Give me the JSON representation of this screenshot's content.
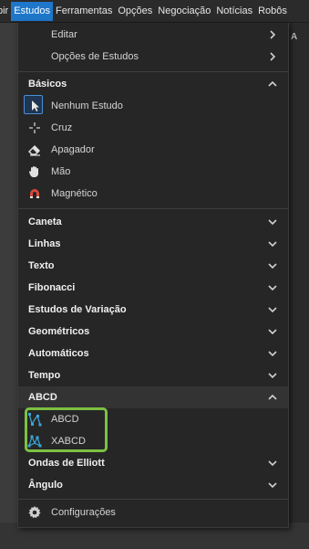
{
  "menubar": {
    "items": [
      "bir",
      "Estudos",
      "Ferramentas",
      "Opções",
      "Negociação",
      "Notícias",
      "Robôs"
    ]
  },
  "side_glyph": "A",
  "menu": {
    "top_items": [
      "Editar",
      "Opções de Estudos"
    ],
    "basicos": {
      "title": "Básicos",
      "items": [
        "Nenhum Estudo",
        "Cruz",
        "Apagador",
        "Mão",
        "Magnético"
      ]
    },
    "groups_a": [
      "Caneta",
      "Linhas",
      "Texto",
      "Fibonacci",
      "Estudos de Variação",
      "Geométricos",
      "Automáticos",
      "Tempo"
    ],
    "abcd": {
      "title": "ABCD",
      "items": [
        "ABCD",
        "XABCD"
      ]
    },
    "groups_b": [
      "Ondas de Elliott",
      "Ângulo"
    ],
    "settings": "Configurações"
  },
  "colors": {
    "accent": "#1f77c9",
    "highlight": "#7cc142",
    "abcd_icon": "#3aa6d6",
    "magnet": "#d84a3a"
  }
}
